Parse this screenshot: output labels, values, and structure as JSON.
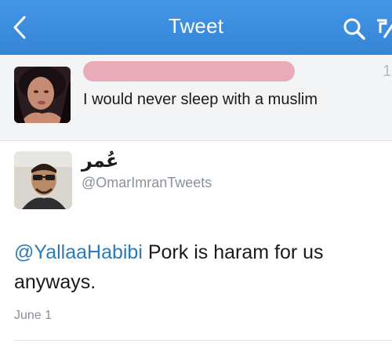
{
  "navbar": {
    "title": "Tweet",
    "back_icon": "chevron-left-icon",
    "search_icon": "search-icon",
    "compose_icon": "compose-icon",
    "color": "#3d8fe0"
  },
  "quoted_tweet": {
    "text": "I would never sleep with a muslim",
    "redaction_color": "#e8a4b3",
    "edge_text": "1"
  },
  "tweet": {
    "author_name": "عُمر",
    "author_handle": "@OmarImranTweets",
    "mention": "@YallaaHabibi",
    "body": " Pork is haram for us anyways.",
    "date": "June 1",
    "mention_color": "#2b7bb9"
  }
}
